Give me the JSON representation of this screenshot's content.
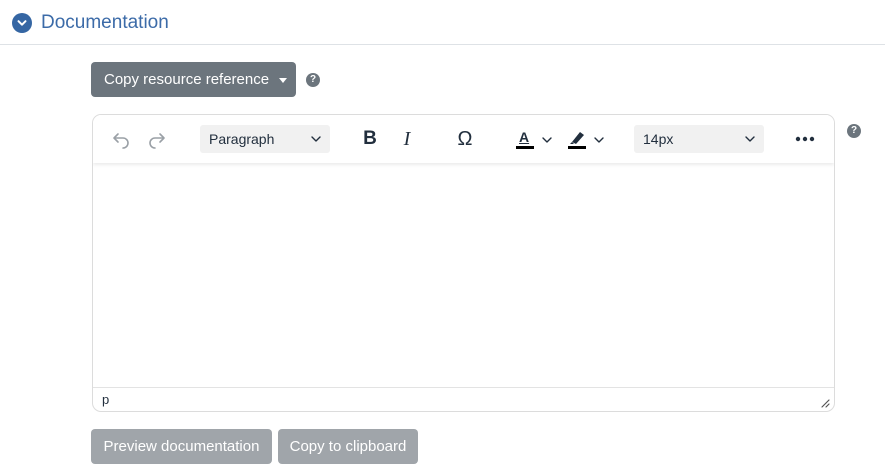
{
  "section": {
    "title": "Documentation",
    "toggle_icon": "chevron-down-circle-icon",
    "accent_color": "#3566a3"
  },
  "copy_reference": {
    "label": "Copy resource reference"
  },
  "help": {
    "glyph": "?"
  },
  "editor": {
    "toolbar": {
      "block_format": "Paragraph",
      "bold": "B",
      "italic": "I",
      "special_char": "Ω",
      "text_color_glyph": "A",
      "font_size": "14px"
    },
    "statusbar": {
      "path": "p"
    }
  },
  "actions": {
    "preview_label": "Preview documentation",
    "copy_label": "Copy to clipboard"
  }
}
